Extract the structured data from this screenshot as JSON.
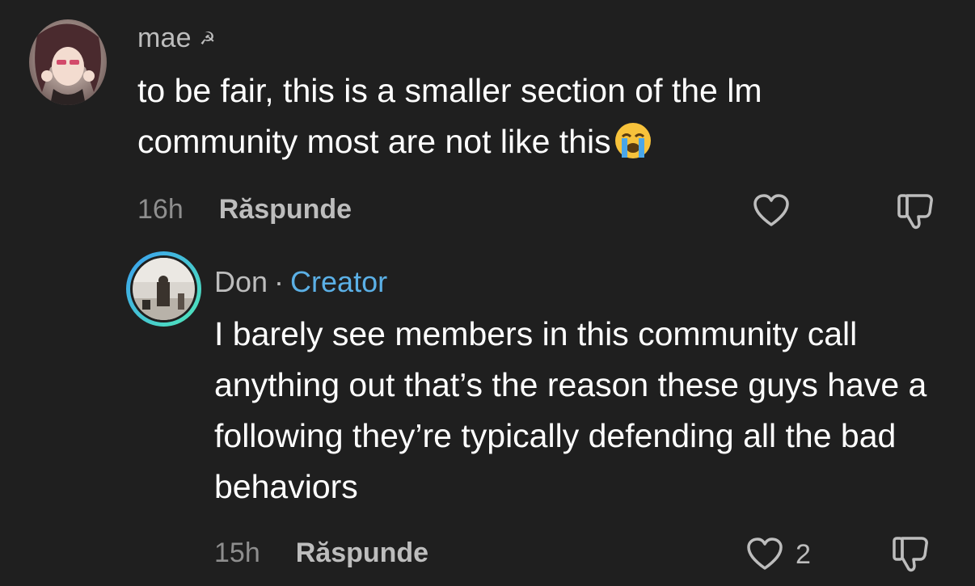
{
  "comment": {
    "username": "mae",
    "username_suffix": "☭",
    "text": "to be fair, this is a smaller section of the lm community most are not like this",
    "emoji": "loudly-crying-face",
    "time": "16h",
    "reply_label": "Răspunde"
  },
  "reply": {
    "username": "Don",
    "separator": "·",
    "badge": "Creator",
    "text": "I barely see members in this community call anything out that’s the reason these guys have a following they’re typically defending all the bad behaviors",
    "time": "15h",
    "reply_label": "Răspunde",
    "like_count": "2"
  },
  "colors": {
    "background": "#1f1f1f",
    "creator_badge": "#5bb0e6",
    "muted_text": "#8e8e8e"
  }
}
